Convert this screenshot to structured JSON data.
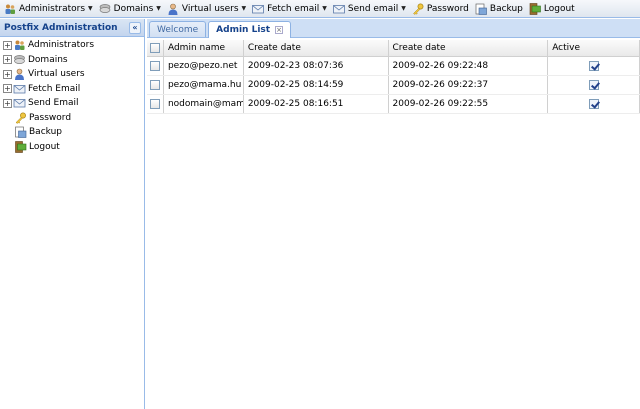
{
  "toolbar": {
    "items": [
      {
        "label": "Administrators",
        "icon": "admin-group-icon",
        "has_menu": true
      },
      {
        "label": "Domains",
        "icon": "domains-icon",
        "has_menu": true
      },
      {
        "label": "Virtual users",
        "icon": "user-icon",
        "has_menu": true
      },
      {
        "label": "Fetch email",
        "icon": "envelope-icon",
        "has_menu": true
      },
      {
        "label": "Send email",
        "icon": "envelope-icon",
        "has_menu": true
      },
      {
        "label": "Password",
        "icon": "key-icon",
        "has_menu": false
      },
      {
        "label": "Backup",
        "icon": "backup-icon",
        "has_menu": false
      },
      {
        "label": "Logout",
        "icon": "logout-icon",
        "has_menu": false
      }
    ],
    "menu_arrow": "▼"
  },
  "left_panel": {
    "title": "Postfix Administration",
    "collapse_glyph": "«",
    "tree": [
      {
        "label": "Administrators",
        "icon": "admin-group-icon",
        "expandable": true
      },
      {
        "label": "Domains",
        "icon": "domains-icon",
        "expandable": true
      },
      {
        "label": "Virtual users",
        "icon": "user-icon",
        "expandable": true
      },
      {
        "label": "Fetch Email",
        "icon": "envelope-icon",
        "expandable": true
      },
      {
        "label": "Send Email",
        "icon": "envelope-icon",
        "expandable": true
      },
      {
        "label": "Password",
        "icon": "key-icon",
        "expandable": false
      },
      {
        "label": "Backup",
        "icon": "backup-icon",
        "expandable": false
      },
      {
        "label": "Logout",
        "icon": "logout-icon",
        "expandable": false
      }
    ],
    "expander_glyph": "+"
  },
  "tabs": [
    {
      "label": "Welcome",
      "active": false,
      "closable": false
    },
    {
      "label": "Admin List",
      "active": true,
      "closable": true
    }
  ],
  "tab_close_glyph": "×",
  "grid": {
    "columns": [
      "",
      "Admin name",
      "Create date",
      "Create date",
      "Active"
    ],
    "rows": [
      {
        "selected": false,
        "admin_name": "pezo@pezo.net",
        "create_date": "2009-02-23 08:07:36",
        "create_date_2": "2009-02-26 09:22:48",
        "active": true
      },
      {
        "selected": false,
        "admin_name": "pezo@mama.hu",
        "create_date": "2009-02-25 08:14:59",
        "create_date_2": "2009-02-26 09:22:37",
        "active": true
      },
      {
        "selected": false,
        "admin_name": "nodomain@mama.h",
        "create_date": "2009-02-25 08:16:51",
        "create_date_2": "2009-02-26 09:22:55",
        "active": true
      }
    ]
  },
  "colors": {
    "accent": "#15428b",
    "border": "#99bbe8",
    "header_bg": "#c3d5ee"
  }
}
